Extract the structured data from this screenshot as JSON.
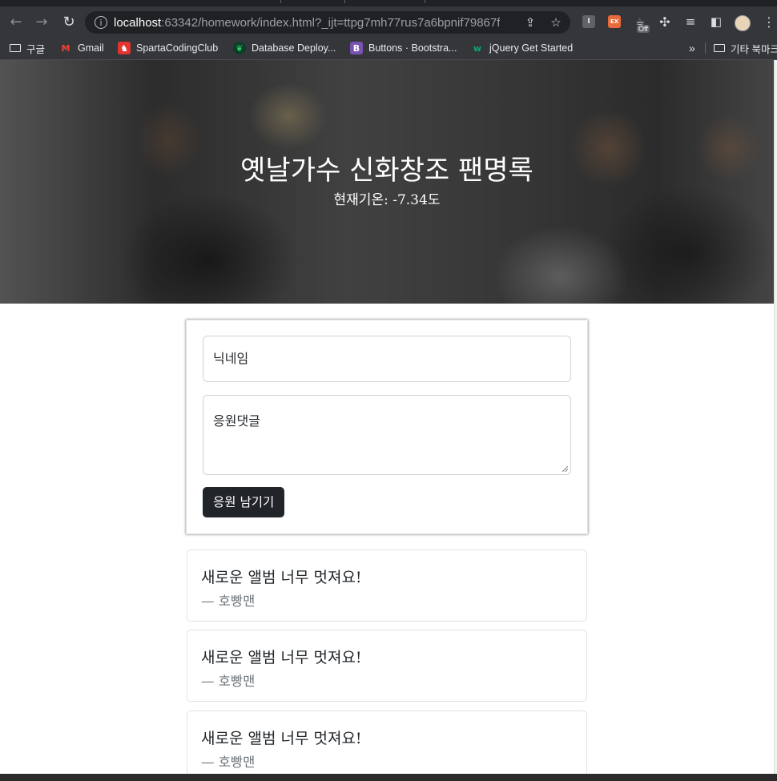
{
  "browser": {
    "url_host": "localhost",
    "url_path": ":63342/homework/index.html?_ijt=ttpg7mh77rus7a6bpnif79867f",
    "extension_badge": "Off",
    "bookmarks": [
      {
        "label": "구글",
        "icon": "folder-icon"
      },
      {
        "label": "Gmail",
        "icon": "gmail-icon"
      },
      {
        "label": "SpartaCodingClub",
        "icon": "sparta-icon"
      },
      {
        "label": "Database Deploy...",
        "icon": "mongodb-icon"
      },
      {
        "label": "Buttons · Bootstra...",
        "icon": "bootstrap-icon"
      },
      {
        "label": "jQuery Get Started",
        "icon": "w3schools-icon"
      }
    ],
    "more_label": "»",
    "other_bookmarks": "기타 북마크"
  },
  "hero": {
    "title": "옛날가수 신화창조 팬명록",
    "temperature": "현재기온: -7.34도"
  },
  "form": {
    "nickname_placeholder": "닉네임",
    "comment_placeholder": "응원댓글",
    "submit_label": "응원 남기기"
  },
  "comments": [
    {
      "message": "새로운 앨범 너무 멋져요!",
      "author": "— 호빵맨"
    },
    {
      "message": "새로운 앨범 너무 멋져요!",
      "author": "— 호빵맨"
    },
    {
      "message": "새로운 앨범 너무 멋져요!",
      "author": "— 호빵맨"
    }
  ],
  "colors": {
    "button_bg": "#212529",
    "author_text": "#6c757d",
    "chrome_toolbar": "#35363a"
  }
}
